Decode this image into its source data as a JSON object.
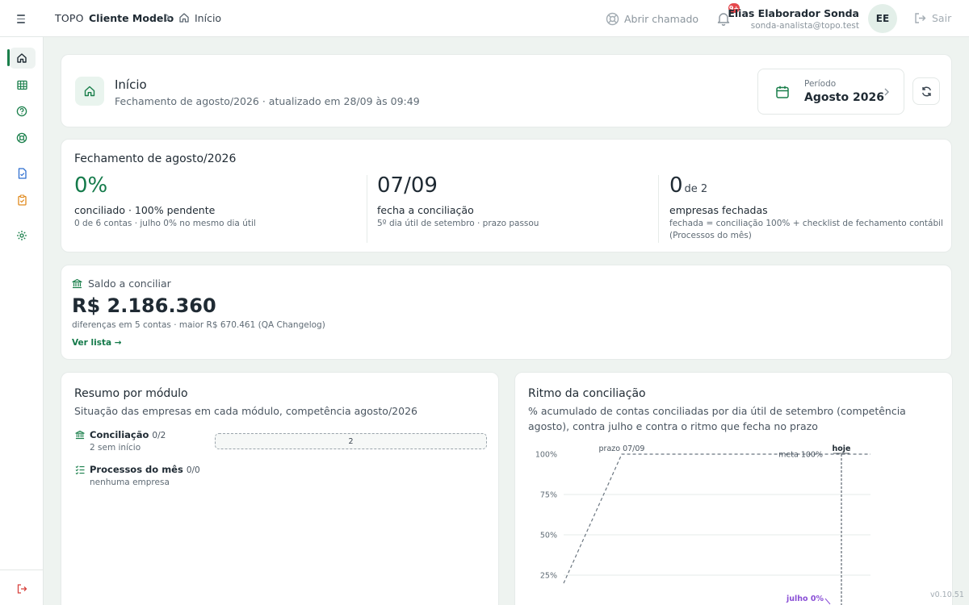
{
  "header": {
    "brand": "TOPO",
    "client": "Cliente Modelo",
    "breadcrumb_current": "Início",
    "abrir_chamado": "Abrir chamado",
    "notifications_badge": "9+",
    "user_name": "Elias Elaborador Sonda",
    "user_email": "sonda-analista@topo.test",
    "avatar_initials": "EE",
    "logout_label": "Sair"
  },
  "sidebar": {
    "items": [
      {
        "icon": "home-icon",
        "active": true
      },
      {
        "icon": "spreadsheet-icon",
        "active": false
      },
      {
        "icon": "help-circle-icon",
        "active": false
      },
      {
        "icon": "lifebuoy-icon",
        "active": false
      },
      {
        "icon": "document-icon",
        "active": false
      },
      {
        "icon": "clipboard-check-icon",
        "active": false
      },
      {
        "icon": "gear-icon",
        "active": false
      }
    ],
    "bottom_icon": "logout-icon"
  },
  "title_card": {
    "title": "Início",
    "subtitle": "Fechamento de agosto/2026 · atualizado em 28/09 às 09:49",
    "period_label": "Período",
    "period_value": "Agosto 2026"
  },
  "fechamento": {
    "title": "Fechamento de agosto/2026",
    "kpi1": {
      "value": "0%",
      "label": "conciliado · 100% pendente",
      "note": "0 de 6 contas · julho 0% no mesmo dia útil"
    },
    "kpi2": {
      "value": "07/09",
      "label": "fecha a conciliação",
      "note": "5º dia útil de setembro · prazo passou"
    },
    "kpi3": {
      "value": "0",
      "suffix": "de 2",
      "label": "empresas fechadas",
      "note1": "fechada = conciliação 100% + checklist de fechamento contábil",
      "note2": "(Processos do mês)"
    }
  },
  "saldo": {
    "label": "Saldo a conciliar",
    "value": "R$ 2.186.360",
    "note": "diferenças em 5 contas · maior R$ 670.461 (QA Changelog)",
    "link": "Ver lista →"
  },
  "resumo": {
    "title": "Resumo por módulo",
    "subtitle": "Situação das empresas em cada módulo, competência agosto/2026",
    "modules": [
      {
        "name": "Conciliação",
        "count": "0/2",
        "sub": "2 sem início",
        "bar_value": "2"
      },
      {
        "name": "Processos do mês",
        "count": "0/0",
        "sub": "nenhuma empresa"
      }
    ]
  },
  "ritmo": {
    "title": "Ritmo da conciliação",
    "subtitle": "% acumulado de contas conciliadas por dia útil de setembro (competência agosto), contra julho e contra o ritmo que fecha no prazo",
    "labels": {
      "prazo": "prazo 07/09",
      "hoje": "hoje",
      "meta": "meta 100%",
      "julho": "julho 0%"
    }
  },
  "chart_data": {
    "type": "line",
    "title": "Ritmo da conciliação",
    "ylabel": "",
    "xlabel": "",
    "ylim": [
      0,
      100
    ],
    "y_ticks": [
      "100%",
      "75%",
      "50%",
      "25%"
    ],
    "y_tick_values": [
      100,
      75,
      50,
      25
    ],
    "series": [
      {
        "name": "ritmo que fecha no prazo",
        "values": [
          20,
          100,
          100
        ],
        "style": "dashed"
      }
    ],
    "annotations": [
      "prazo 07/09",
      "meta 100%",
      "hoje",
      "julho 0%"
    ],
    "colors": {
      "pace": "#6b7680",
      "today": "#3a4550",
      "julho": "#8a4fd6",
      "grid": "#e6ebe9"
    }
  },
  "footer": {
    "version": "v0.10.51"
  },
  "colors": {
    "accent": "#147a4a",
    "badge": "#e5484d",
    "background": "#eef3f0"
  }
}
